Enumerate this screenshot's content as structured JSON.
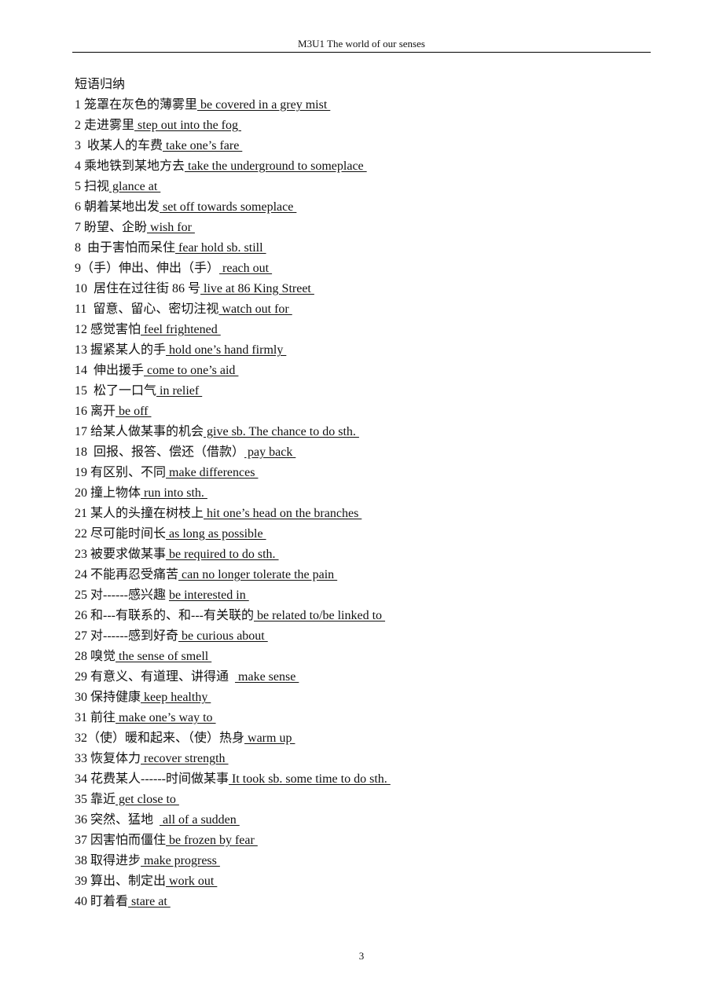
{
  "header": {
    "title": "M3U1 The world of our senses"
  },
  "section_title": "短语归纳",
  "items": [
    {
      "num": "1",
      "sep": " ",
      "zh": "笼罩在灰色的薄雾里",
      "en": " be covered in a grey mist "
    },
    {
      "num": "2",
      "sep": " ",
      "zh": "走进雾里",
      "en": " step out into the fog "
    },
    {
      "num": "3",
      "sep": "  ",
      "zh": "收某人的车费",
      "en": " take one’s fare "
    },
    {
      "num": "4",
      "sep": " ",
      "zh": "乘地铁到某地方去",
      "en": " take the underground to someplace "
    },
    {
      "num": "5",
      "sep": " ",
      "zh": "扫视",
      "en": " glance at "
    },
    {
      "num": "6",
      "sep": " ",
      "zh": "朝着某地出发",
      "en": " set off towards someplace "
    },
    {
      "num": "7",
      "sep": " ",
      "zh": "盼望、企盼",
      "en": " wish for "
    },
    {
      "num": "8",
      "sep": "  ",
      "zh": "由于害怕而呆住",
      "en": " fear hold sb. still "
    },
    {
      "num": "9",
      "sep": "",
      "zh": "（手）伸出、伸出（手）",
      "en": " reach out "
    },
    {
      "num": "10",
      "sep": "  ",
      "zh": "居住在过往街 86 号",
      "en": " live at 86 King Street "
    },
    {
      "num": "11",
      "sep": "  ",
      "zh": "留意、留心、密切注视",
      "en": " watch out for "
    },
    {
      "num": "12",
      "sep": " ",
      "zh": "感觉害怕",
      "en": " feel frightened "
    },
    {
      "num": "13",
      "sep": " ",
      "zh": "握紧某人的手",
      "en": " hold one’s hand firmly "
    },
    {
      "num": "14",
      "sep": "  ",
      "zh": "伸出援手",
      "en": " come to one’s aid "
    },
    {
      "num": "15",
      "sep": "  ",
      "zh": "松了一口气",
      "en": " in relief "
    },
    {
      "num": "16",
      "sep": " ",
      "zh": "离开",
      "en": " be off "
    },
    {
      "num": "17",
      "sep": " ",
      "zh": "给某人做某事的机会",
      "en": " give sb. The chance to do sth. "
    },
    {
      "num": "18",
      "sep": "  ",
      "zh": "回报、报答、偿还（借款）",
      "en": " pay back "
    },
    {
      "num": "19",
      "sep": " ",
      "zh": "有区别、不同",
      "en": " make differences "
    },
    {
      "num": "20",
      "sep": " ",
      "zh": "撞上物体",
      "en": " run into sth. "
    },
    {
      "num": "21",
      "sep": " ",
      "zh": "某人的头撞在树枝上",
      "en": " hit one’s head on the branches "
    },
    {
      "num": "22",
      "sep": " ",
      "zh": "尽可能时间长",
      "en": " as long as possible "
    },
    {
      "num": "23",
      "sep": " ",
      "zh": "被要求做某事",
      "en": " be required to do sth. "
    },
    {
      "num": "24",
      "sep": " ",
      "zh": "不能再忍受痛苦",
      "en": " can no longer tolerate the pain "
    },
    {
      "num": "25",
      "sep": " ",
      "zh": "对------感兴趣 ",
      "en": "be interested in "
    },
    {
      "num": "26",
      "sep": " ",
      "zh": "和---有联系的、和---有关联的",
      "en": " be related to/be linked to "
    },
    {
      "num": "27",
      "sep": " ",
      "zh": "对------感到好奇",
      "en": " be curious about "
    },
    {
      "num": "28",
      "sep": " ",
      "zh": "嗅觉",
      "en": " the sense of smell "
    },
    {
      "num": "29",
      "sep": " ",
      "zh": "有意义、有道理、讲得通  ",
      "en": " make sense "
    },
    {
      "num": "30",
      "sep": " ",
      "zh": "保持健康",
      "en": " keep healthy "
    },
    {
      "num": "31",
      "sep": " ",
      "zh": "前往",
      "en": " make one’s way to "
    },
    {
      "num": "32",
      "sep": "",
      "zh": "（使）暖和起来、（使）热身",
      "en": " warm up "
    },
    {
      "num": "33",
      "sep": " ",
      "zh": "恢复体力",
      "en": " recover strength "
    },
    {
      "num": "34",
      "sep": " ",
      "zh": "花费某人------时间做某事",
      "en": " It took sb. some time to do sth. "
    },
    {
      "num": "35",
      "sep": " ",
      "zh": "靠近",
      "en": " get close to "
    },
    {
      "num": "36",
      "sep": " ",
      "zh": "突然、猛地  ",
      "en": " all of a sudden "
    },
    {
      "num": "37",
      "sep": " ",
      "zh": "因害怕而僵住",
      "en": " be frozen by fear "
    },
    {
      "num": "38",
      "sep": " ",
      "zh": "取得进步",
      "en": " make progress "
    },
    {
      "num": "39",
      "sep": " ",
      "zh": "算出、制定出",
      "en": " work out "
    },
    {
      "num": "40",
      "sep": " ",
      "zh": "盯着看",
      "en": " stare at "
    }
  ],
  "footer": {
    "page_number": "3"
  }
}
